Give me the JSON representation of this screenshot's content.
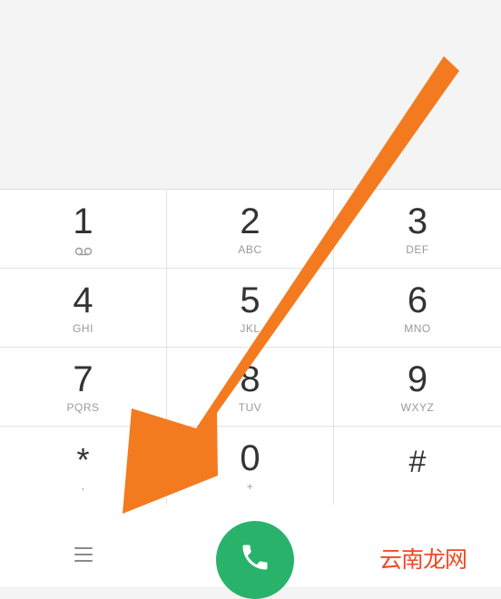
{
  "dialpad": {
    "keys": [
      {
        "digit": "1",
        "letters": "",
        "icon": "voicemail-icon"
      },
      {
        "digit": "2",
        "letters": "ABC"
      },
      {
        "digit": "3",
        "letters": "DEF"
      },
      {
        "digit": "4",
        "letters": "GHI"
      },
      {
        "digit": "5",
        "letters": "JKL"
      },
      {
        "digit": "6",
        "letters": "MNO"
      },
      {
        "digit": "7",
        "letters": "PQRS"
      },
      {
        "digit": "8",
        "letters": "TUV"
      },
      {
        "digit": "9",
        "letters": "WXYZ"
      },
      {
        "digit": "*",
        "letters": ","
      },
      {
        "digit": "0",
        "letters": "+"
      },
      {
        "digit": "#",
        "letters": ""
      }
    ]
  },
  "bottom_bar": {
    "menu_icon": "menu-icon",
    "call_icon": "phone-icon",
    "call_color": "#29b36a"
  },
  "watermark": {
    "text": "云南龙网"
  },
  "annotation": {
    "arrow_color": "#f47a20"
  }
}
